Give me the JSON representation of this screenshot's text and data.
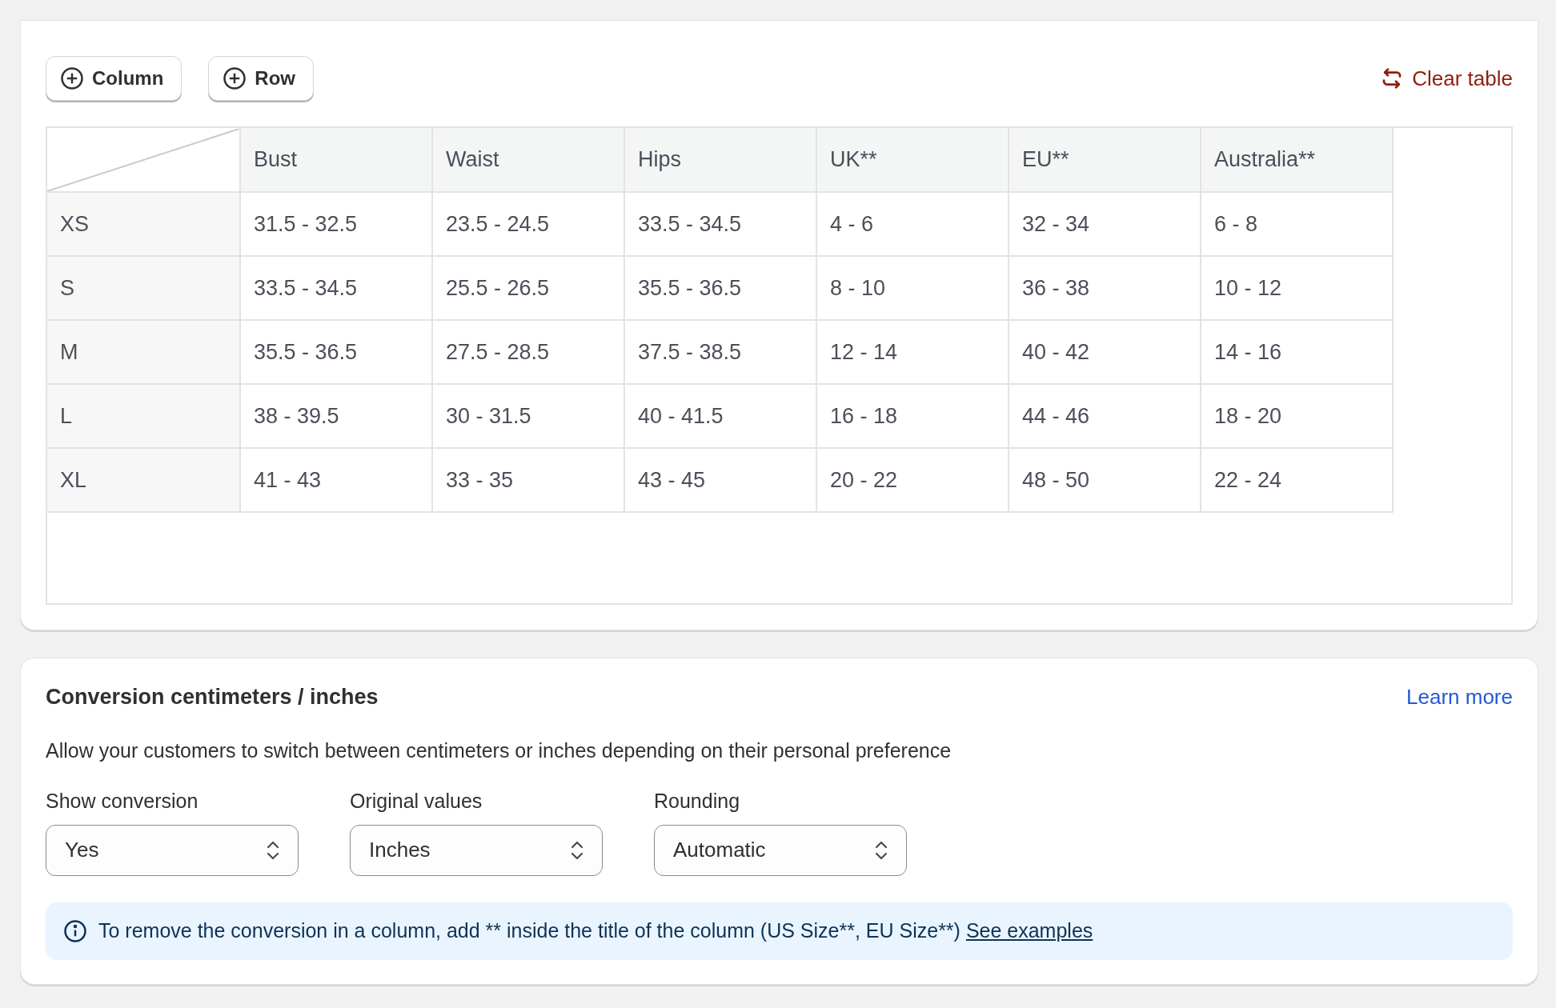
{
  "toolbar": {
    "buttons": [
      {
        "label": "Column"
      },
      {
        "label": "Row"
      }
    ],
    "clear": "Clear table"
  },
  "table": {
    "columns": [
      "Bust",
      "Waist",
      "Hips",
      "UK**",
      "EU**",
      "Australia**"
    ],
    "rows": [
      {
        "label": "XS",
        "cells": [
          "31.5 - 32.5",
          "23.5 - 24.5",
          "33.5 - 34.5",
          "4 - 6",
          "32 - 34",
          "6 - 8"
        ]
      },
      {
        "label": "S",
        "cells": [
          "33.5 - 34.5",
          "25.5 - 26.5",
          "35.5 - 36.5",
          "8 - 10",
          "36 - 38",
          "10 - 12"
        ]
      },
      {
        "label": "M",
        "cells": [
          "35.5 - 36.5",
          "27.5 - 28.5",
          "37.5 - 38.5",
          "12 - 14",
          "40 - 42",
          "14 - 16"
        ]
      },
      {
        "label": "L",
        "cells": [
          "38 - 39.5",
          "30 - 31.5",
          "40 - 41.5",
          "16 - 18",
          "44 - 46",
          "18 - 20"
        ]
      },
      {
        "label": "XL",
        "cells": [
          "41 - 43",
          "33 - 35",
          "43 - 45",
          "20 - 22",
          "48 - 50",
          "22 - 24"
        ]
      }
    ]
  },
  "conversion": {
    "title": "Conversion centimeters / inches",
    "learn_more": "Learn more",
    "description": "Allow your customers to switch between centimeters or inches depending on their personal preference",
    "selects": [
      {
        "label": "Show conversion",
        "value": "Yes"
      },
      {
        "label": "Original values",
        "value": "Inches"
      },
      {
        "label": "Rounding",
        "value": "Automatic"
      }
    ],
    "notice": {
      "text": "To remove the conversion in a column, add ** inside the title of the column (US Size**, EU Size**)",
      "link": "See examples"
    }
  }
}
